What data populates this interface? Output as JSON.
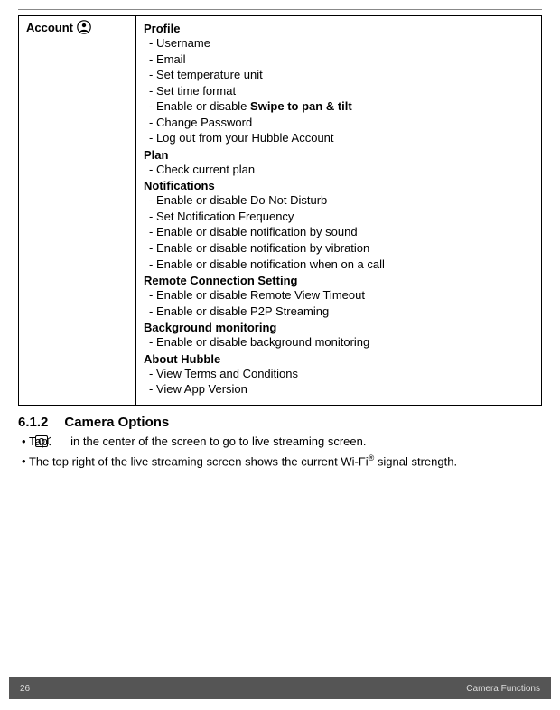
{
  "table": {
    "left_label": "Account",
    "sections": [
      {
        "title": "Profile",
        "items": [
          {
            "text": "Username"
          },
          {
            "text": "Email"
          },
          {
            "text": "Set temperature unit"
          },
          {
            "text": "Set time format"
          },
          {
            "prefix": "Enable or disable ",
            "bold": "Swipe to pan & tilt"
          },
          {
            "text": "Change Password"
          },
          {
            "text": "Log out from your Hubble Account"
          }
        ]
      },
      {
        "title": "Plan",
        "items": [
          {
            "text": "Check current plan"
          }
        ]
      },
      {
        "title": "Notifications",
        "items": [
          {
            "text": "Enable or disable Do Not Disturb"
          },
          {
            "text": "Set Notification Frequency"
          },
          {
            "text": "Enable or disable notification by sound"
          },
          {
            "text": "Enable or disable notification by vibration"
          },
          {
            "text": "Enable or disable notification when on a call"
          }
        ]
      },
      {
        "title": "Remote Connection Setting",
        "items": [
          {
            "text": "Enable or disable Remote View Timeout"
          },
          {
            "text": "Enable or disable P2P Streaming"
          }
        ]
      },
      {
        "title": "Background monitoring",
        "items": [
          {
            "text": "Enable or disable background monitoring"
          }
        ]
      },
      {
        "title": "About Hubble",
        "items": [
          {
            "text": "View Terms and Conditions"
          },
          {
            "text": "View App Version"
          }
        ]
      }
    ]
  },
  "heading": {
    "num": "6.1.2",
    "title": "Camera Options"
  },
  "bullets": [
    {
      "pre": "Tap ",
      "post": " in the center of the screen to go to live streaming screen.",
      "icon": true
    },
    {
      "pre": "The top right of the live streaming screen shows the current Wi-Fi",
      "sup": "®",
      "post": " signal strength."
    }
  ],
  "footer": {
    "page": "26",
    "title": "Camera Functions"
  }
}
